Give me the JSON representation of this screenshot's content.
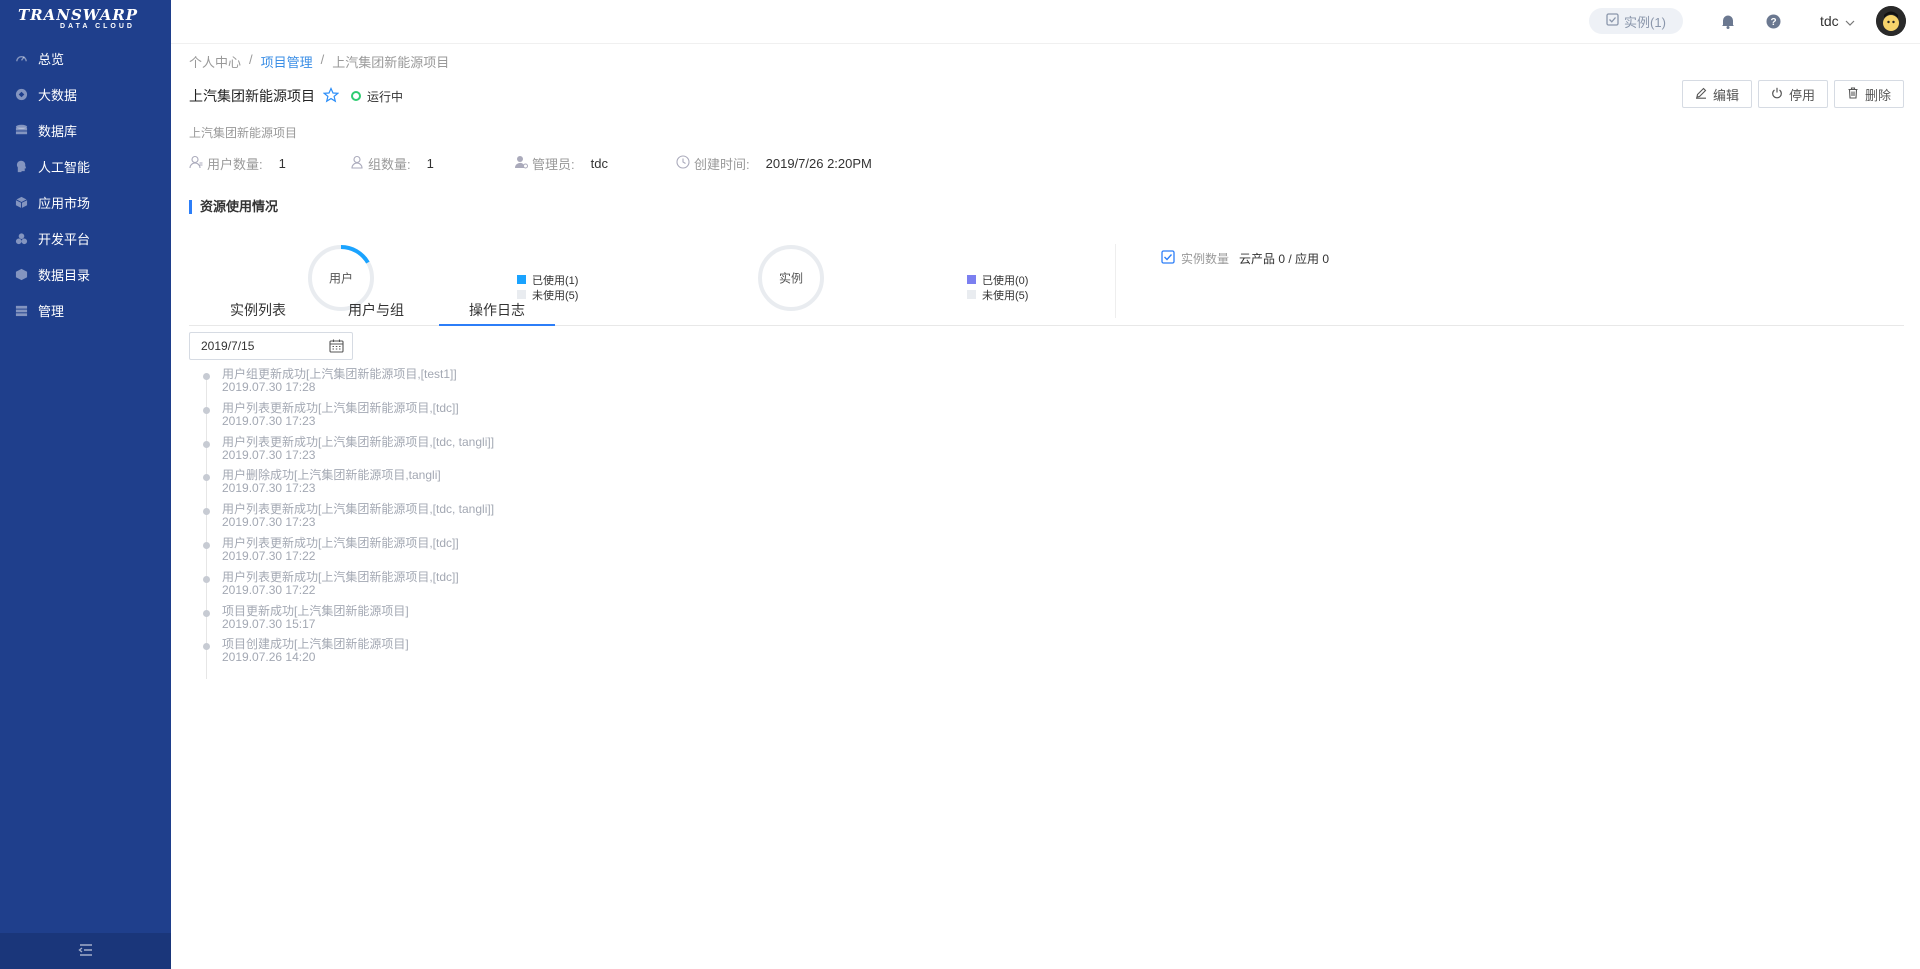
{
  "logo": {
    "main": "TRANSWARP",
    "sub": "DATA CLOUD"
  },
  "sidebar": {
    "items": [
      {
        "label": "总览",
        "icon": "speedometer-icon"
      },
      {
        "label": "大数据",
        "icon": "bigdata-icon"
      },
      {
        "label": "数据库",
        "icon": "database-icon"
      },
      {
        "label": "人工智能",
        "icon": "ai-icon"
      },
      {
        "label": "应用市场",
        "icon": "market-icon"
      },
      {
        "label": "开发平台",
        "icon": "dev-icon"
      },
      {
        "label": "数据目录",
        "icon": "catalog-icon"
      },
      {
        "label": "管理",
        "icon": "manage-icon"
      }
    ]
  },
  "header": {
    "instance_pill": "实例(1)",
    "user": "tdc"
  },
  "breadcrumb": {
    "items": [
      "个人中心",
      "项目管理",
      "上汽集团新能源项目"
    ],
    "sep": "/"
  },
  "project": {
    "title": "上汽集团新能源项目",
    "status": "运行中",
    "description": "上汽集团新能源项目"
  },
  "actions": {
    "edit": "编辑",
    "disable": "停用",
    "delete": "删除"
  },
  "meta": {
    "users_label": "用户数量:",
    "users": "1",
    "groups_label": "组数量:",
    "groups": "1",
    "admin_label": "管理员:",
    "admin": "tdc",
    "created_label": "创建时间:",
    "created": "2019/7/26 2:20PM"
  },
  "resources": {
    "title": "资源使用情况",
    "user_gauge": {
      "label": "用户",
      "used_label": "已使用(1)",
      "unused_label": "未使用(5)",
      "used": 1,
      "total": 6,
      "color": "#1aa3ff"
    },
    "instance_gauge": {
      "label": "实例",
      "used_label": "已使用(0)",
      "unused_label": "未使用(5)",
      "used": 0,
      "total": 5,
      "color": "#7b7ff0"
    },
    "instance_count_label": "实例数量",
    "instance_count_value": "云产品 0 / 应用 0"
  },
  "tabs": [
    {
      "label": "实例列表"
    },
    {
      "label": "用户与组"
    },
    {
      "label": "操作日志"
    }
  ],
  "date_filter": {
    "value": "2019/7/15"
  },
  "logs": [
    {
      "text": "用户组更新成功[上汽集团新能源项目,[test1]]",
      "time": "2019.07.30 17:28"
    },
    {
      "text": "用户列表更新成功[上汽集团新能源项目,[tdc]]",
      "time": "2019.07.30 17:23"
    },
    {
      "text": "用户列表更新成功[上汽集团新能源项目,[tdc, tangli]]",
      "time": "2019.07.30 17:23"
    },
    {
      "text": "用户删除成功[上汽集团新能源项目,tangli]",
      "time": "2019.07.30 17:23"
    },
    {
      "text": "用户列表更新成功[上汽集团新能源项目,[tdc, tangli]]",
      "time": "2019.07.30 17:23"
    },
    {
      "text": "用户列表更新成功[上汽集团新能源项目,[tdc]]",
      "time": "2019.07.30 17:22"
    },
    {
      "text": "用户列表更新成功[上汽集团新能源项目,[tdc]]",
      "time": "2019.07.30 17:22"
    },
    {
      "text": "项目更新成功[上汽集团新能源项目]",
      "time": "2019.07.30 15:17"
    },
    {
      "text": "项目创建成功[上汽集团新能源项目]",
      "time": "2019.07.26 14:20"
    }
  ]
}
